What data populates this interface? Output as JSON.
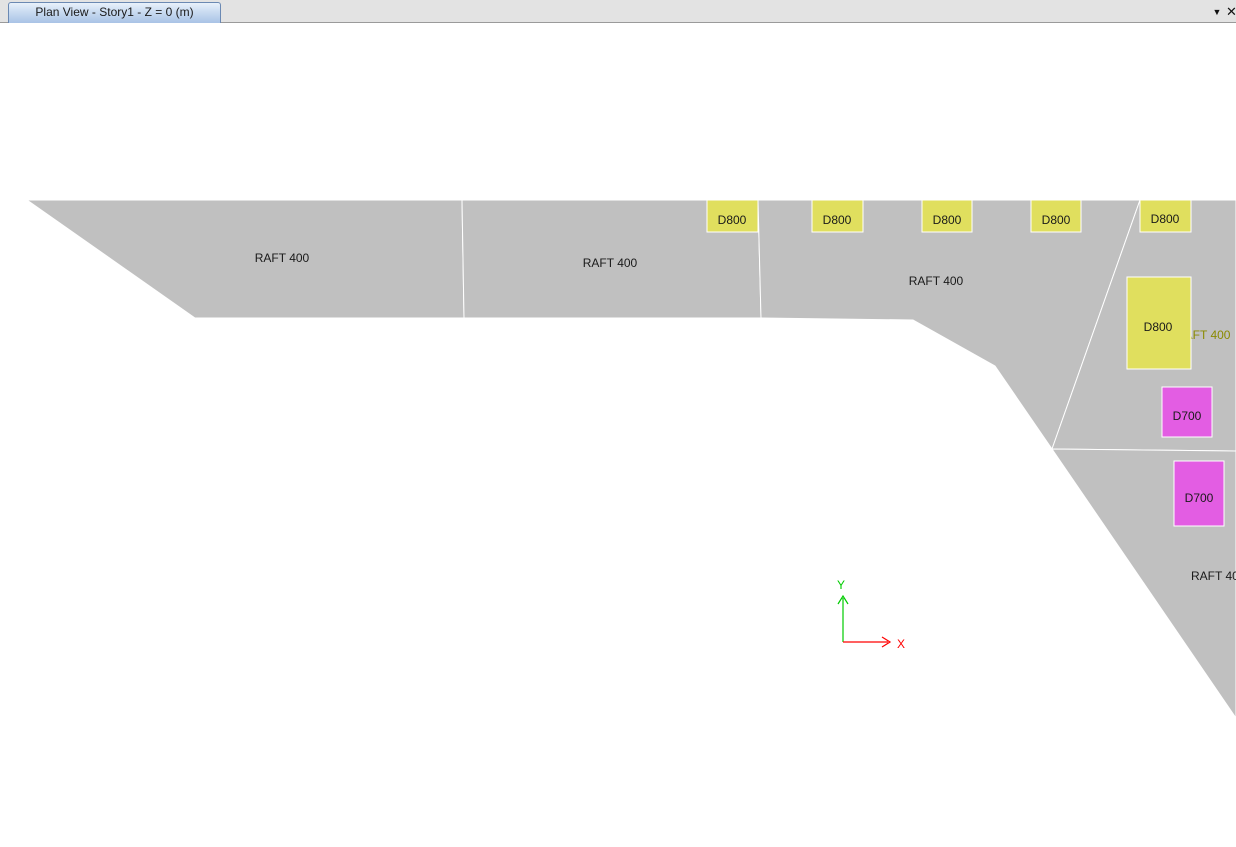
{
  "window": {
    "tab_title": "Plan View - Story1 - Z = 0 (m)",
    "dropdown_glyph": "▼",
    "close_glyph": "✕"
  },
  "slabs": [
    {
      "label": "RAFT 400"
    },
    {
      "label": "RAFT 400"
    },
    {
      "label": "RAFT 400"
    },
    {
      "label": "RAFT 400"
    },
    {
      "label": "RAFT 40"
    }
  ],
  "piles": [
    {
      "label": "D800",
      "color": "#e0df5e"
    },
    {
      "label": "D800",
      "color": "#e0df5e"
    },
    {
      "label": "D800",
      "color": "#e0df5e"
    },
    {
      "label": "D800",
      "color": "#e0df5e"
    },
    {
      "label": "D800",
      "color": "#e0df5e"
    },
    {
      "label": "D800",
      "color": "#e0df5e"
    },
    {
      "label": "D700",
      "color": "#e35de3"
    },
    {
      "label": "D700",
      "color": "#e35de3"
    }
  ],
  "axes": {
    "x_label": "X",
    "y_label": "Y",
    "x_color": "#ff0000",
    "y_color": "#00cc00"
  },
  "colors": {
    "slab_fill": "#c0c0c0",
    "slab_edge": "#ffffff",
    "overlap_label": "#8a8a00"
  }
}
